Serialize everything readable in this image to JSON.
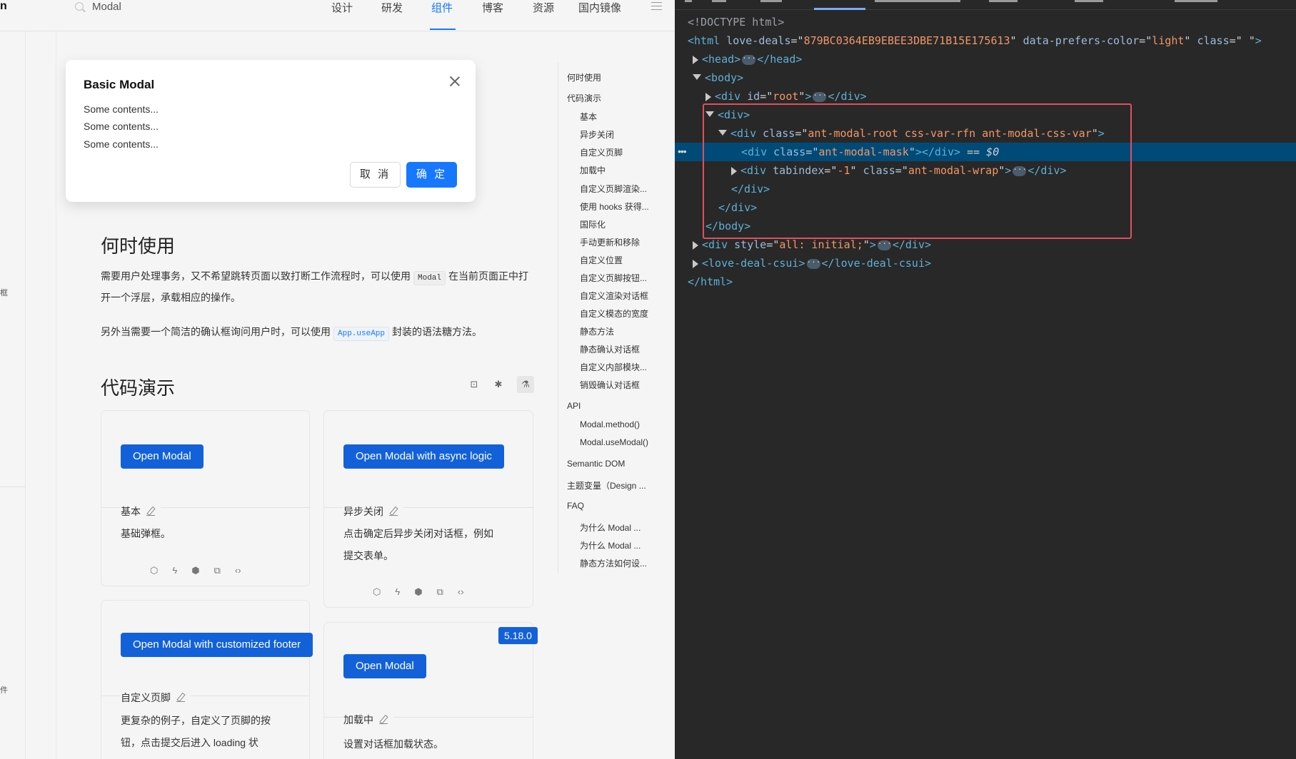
{
  "docs": {
    "logo_fragment": "n",
    "search": {
      "text": "Modal"
    },
    "nav": [
      {
        "label": "设计"
      },
      {
        "label": "研发"
      },
      {
        "label": "组件",
        "active": true
      },
      {
        "label": "博客"
      },
      {
        "label": "资源"
      },
      {
        "label": "国内镜像"
      }
    ],
    "side_fragments": [
      "框",
      "件"
    ],
    "sections": {
      "when_to_use": {
        "title": "何时使用",
        "para1_before": "需要用户处理事务，又不希望跳转页面以致打断工作流程时，可以使用",
        "para1_code": "Modal",
        "para1_after": "在当前页面正中打开一个浮层，承载相应的操作。",
        "para2_before": "另外当需要一个简洁的确认框询问用户时，可以使用",
        "para2_code": "App.useApp",
        "para2_after": "封装的语法糖方法。"
      },
      "demos": {
        "title": "代码演示"
      }
    },
    "tools": {
      "icons": [
        "code-expand-icon",
        "bug-icon",
        "beaker-icon"
      ]
    },
    "cards": [
      {
        "button": "Open Modal",
        "title": "基本",
        "desc": "基础弹框。"
      },
      {
        "button": "Open Modal with async logic",
        "title": "异步关闭",
        "desc_lines": [
          "点击确定后异步关闭对话框，例如",
          "提交表单。"
        ]
      },
      {
        "button": "Open Modal with customized footer",
        "title": "自定义页脚",
        "desc_lines": [
          "更复杂的例子，自定义了页脚的按",
          "钮，点击提交后进入 loading 状"
        ]
      },
      {
        "button": "Open Modal",
        "title": "加载中",
        "desc": "设置对话框加载状态。",
        "version": "5.18.0"
      }
    ],
    "card_actions": [
      "codesandbox-icon",
      "lightning-icon",
      "codepen-icon",
      "external-link-icon",
      "code-icon"
    ],
    "anchors": [
      {
        "label": "何时使用",
        "level": 1
      },
      {
        "label": "代码演示",
        "level": 1
      },
      {
        "label": "基本",
        "level": 2
      },
      {
        "label": "异步关闭",
        "level": 2
      },
      {
        "label": "自定义页脚",
        "level": 2
      },
      {
        "label": "加载中",
        "level": 2
      },
      {
        "label": "自定义页脚渲染...",
        "level": 2
      },
      {
        "label": "使用 hooks 获得...",
        "level": 2
      },
      {
        "label": "国际化",
        "level": 2
      },
      {
        "label": "手动更新和移除",
        "level": 2
      },
      {
        "label": "自定义位置",
        "level": 2
      },
      {
        "label": "自定义页脚按钮...",
        "level": 2
      },
      {
        "label": "自定义渲染对话框",
        "level": 2
      },
      {
        "label": "自定义模态的宽度",
        "level": 2
      },
      {
        "label": "静态方法",
        "level": 2
      },
      {
        "label": "静态确认对话框",
        "level": 2
      },
      {
        "label": "自定义内部模块...",
        "level": 2
      },
      {
        "label": "销毁确认对话框",
        "level": 2
      },
      {
        "label": "API",
        "level": 1
      },
      {
        "label": "Modal.method()",
        "level": 2
      },
      {
        "label": "Modal.useModal()",
        "level": 2
      },
      {
        "label": "Semantic DOM",
        "level": 1
      },
      {
        "label": "主题变量（Design ...",
        "level": 1
      },
      {
        "label": "FAQ",
        "level": 1
      },
      {
        "label": "为什么 Modal ...",
        "level": 2
      },
      {
        "label": "为什么 Modal ...",
        "level": 2
      },
      {
        "label": "静态方法如何设...",
        "level": 2
      }
    ]
  },
  "modal": {
    "title": "Basic Modal",
    "lines": [
      "Some contents...",
      "Some contents...",
      "Some contents..."
    ],
    "cancel": "取 消",
    "ok": "确 定"
  },
  "devtools": {
    "doctype": "<!DOCTYPE html>",
    "html_attrs": [
      {
        "name": "love-deals",
        "value": "879BC0364EB9EBEE3DBE71B15E175613"
      },
      {
        "name": "data-prefers-color",
        "value": "light"
      },
      {
        "name": "class",
        "value": " "
      }
    ],
    "head": "head",
    "body": "body",
    "root_id": "root",
    "modal_root_class": "ant-modal-root css-var-rfn ant-modal-css-var",
    "modal_mask_class": "ant-modal-mask",
    "selected_marker": "== $0",
    "wrap_tabindex": "-1",
    "wrap_class": "ant-modal-wrap",
    "style_value": "all: initial;",
    "csui_tag": "love-deal-csui",
    "colors": {
      "tag": "#5db0d7",
      "attr": "#9bbbdc",
      "value": "#f29766",
      "selection": "#004a77",
      "highlight": "#e0505e"
    }
  }
}
